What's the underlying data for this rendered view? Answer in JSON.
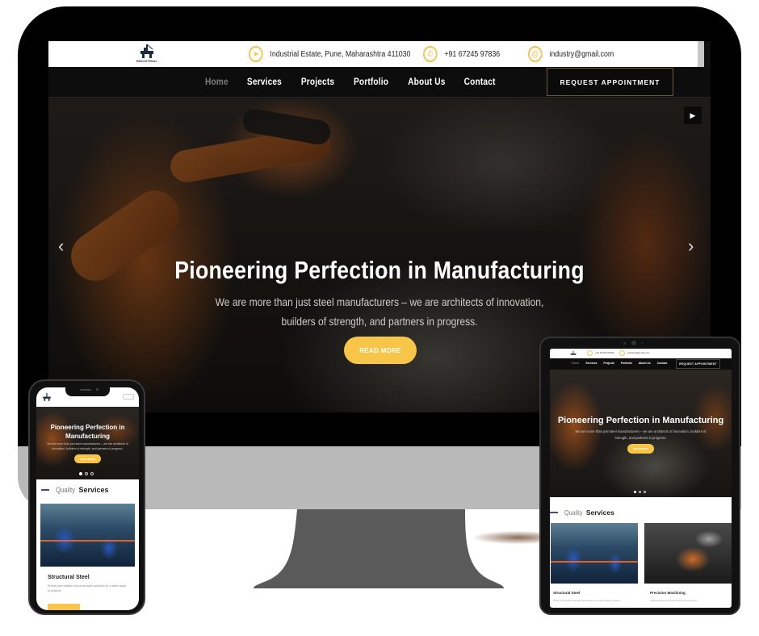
{
  "site": {
    "logo_text": "INDUSTRIAL",
    "contact": {
      "address": "Industrial Estate, Pune, Maharashtra 411030",
      "phone": "+91 67245 97836",
      "email": "industry@gmail.com"
    },
    "nav": {
      "items": [
        {
          "label": "Home",
          "active": true
        },
        {
          "label": "Services",
          "active": false
        },
        {
          "label": "Projects",
          "active": false
        },
        {
          "label": "Portfolio",
          "active": false
        },
        {
          "label": "About Us",
          "active": false
        },
        {
          "label": "Contact",
          "active": false
        }
      ],
      "cta_label": "REQUEST APPOINTMENT"
    },
    "hero": {
      "title": "Pioneering Perfection in Manufacturing",
      "subtitle": "We are more than just steel manufacturers – we are architects of innovation, builders of strength, and partners in progress.",
      "button_label": "READ MORE",
      "slide_count": 3,
      "active_slide": 1
    },
    "services": {
      "heading_light": "Quality",
      "heading_bold": "Services",
      "cards": [
        {
          "title": "Structural Steel",
          "text": "Robust and reliable structural steel solutions for a wide range of projects."
        },
        {
          "title": "Precision Machining",
          "text": "Crafting intricate components with utmost accuracy"
        }
      ]
    }
  },
  "icons": {
    "address": "location-arrow-icon",
    "phone": "phone-icon",
    "email": "email-icon",
    "prev": "chevron-left-icon",
    "next": "chevron-right-icon",
    "play": "play-icon"
  },
  "colors": {
    "accent": "#f7c548",
    "nav_bg": "#0d0d0d",
    "monitor_chin": "#b9b9b9",
    "stand": "#5a5a5a"
  }
}
